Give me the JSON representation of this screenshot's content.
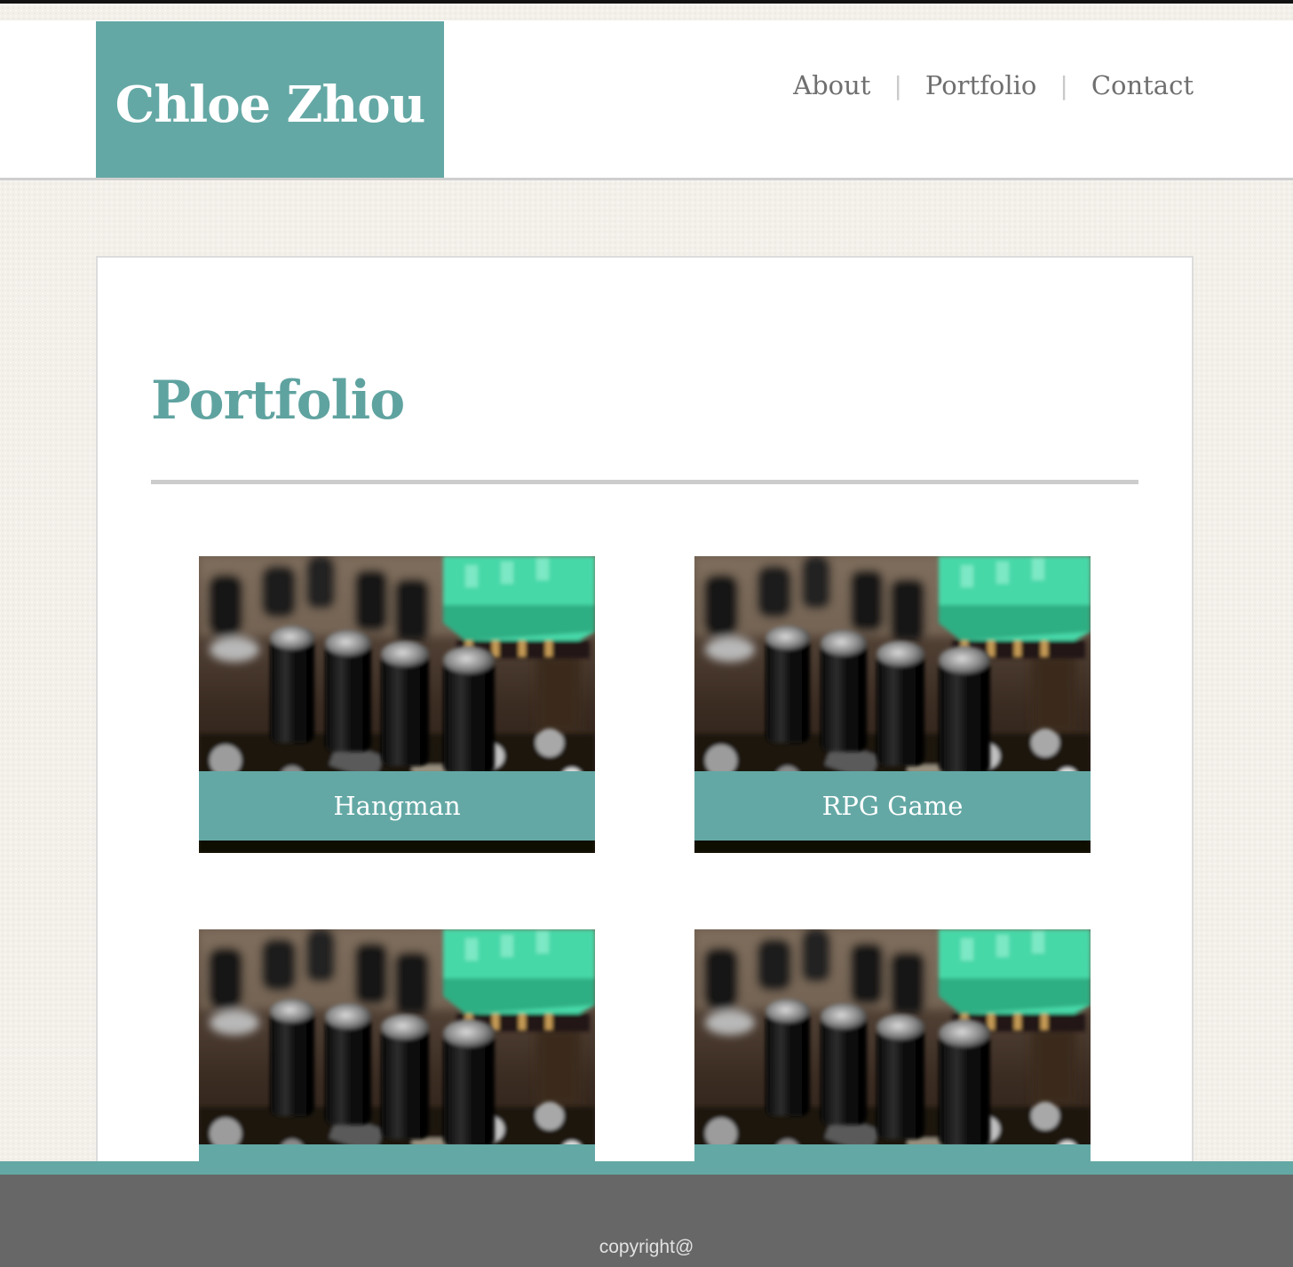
{
  "header": {
    "brand": "Chloe Zhou",
    "nav": [
      {
        "label": "About"
      },
      {
        "label": "Portfolio"
      },
      {
        "label": "Contact"
      }
    ],
    "separator": "|"
  },
  "main": {
    "title": "Portfolio",
    "projects": [
      {
        "title": "Hangman",
        "image": "circuit-board-photo"
      },
      {
        "title": "RPG Game",
        "image": "circuit-board-photo"
      },
      {
        "title": "",
        "image": "circuit-board-photo"
      },
      {
        "title": "",
        "image": "circuit-board-photo"
      }
    ]
  },
  "footer": {
    "text": "copyright@"
  },
  "colors": {
    "accent": "#64a8a5",
    "title": "#5fa3a0",
    "nav_text": "#6f6f6f",
    "footer_bg": "#676767",
    "page_bg": "#f3f0ea"
  }
}
